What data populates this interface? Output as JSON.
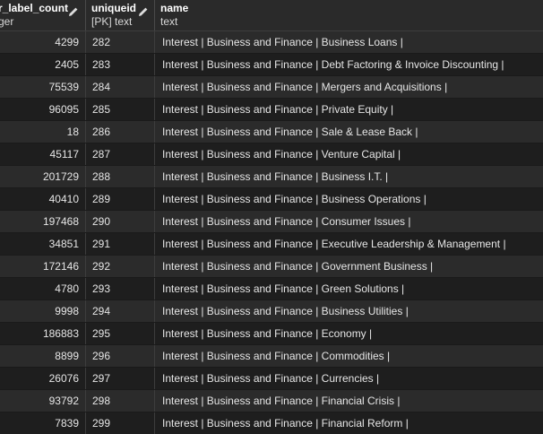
{
  "columns": [
    {
      "name": "r_label_count",
      "type": "ger"
    },
    {
      "name": "uniqueid",
      "type": "[PK] text"
    },
    {
      "name": "name",
      "type": "text"
    }
  ],
  "rows": [
    {
      "count": "4299",
      "id": "282",
      "name": "Interest | Business and Finance | Business Loans |"
    },
    {
      "count": "2405",
      "id": "283",
      "name": "Interest | Business and Finance | Debt Factoring & Invoice Discounting |"
    },
    {
      "count": "75539",
      "id": "284",
      "name": "Interest | Business and Finance | Mergers and Acquisitions |"
    },
    {
      "count": "96095",
      "id": "285",
      "name": "Interest | Business and Finance | Private Equity |"
    },
    {
      "count": "18",
      "id": "286",
      "name": "Interest | Business and Finance | Sale & Lease Back |"
    },
    {
      "count": "45117",
      "id": "287",
      "name": "Interest | Business and Finance | Venture Capital |"
    },
    {
      "count": "201729",
      "id": "288",
      "name": "Interest | Business and Finance | Business I.T. |"
    },
    {
      "count": "40410",
      "id": "289",
      "name": "Interest | Business and Finance | Business Operations |"
    },
    {
      "count": "197468",
      "id": "290",
      "name": "Interest | Business and Finance | Consumer Issues |"
    },
    {
      "count": "34851",
      "id": "291",
      "name": "Interest | Business and Finance | Executive Leadership & Management |"
    },
    {
      "count": "172146",
      "id": "292",
      "name": "Interest | Business and Finance | Government Business |"
    },
    {
      "count": "4780",
      "id": "293",
      "name": "Interest | Business and Finance | Green Solutions |"
    },
    {
      "count": "9998",
      "id": "294",
      "name": "Interest | Business and Finance | Business Utilities |"
    },
    {
      "count": "186883",
      "id": "295",
      "name": "Interest | Business and Finance | Economy |"
    },
    {
      "count": "8899",
      "id": "296",
      "name": "Interest | Business and Finance | Commodities |"
    },
    {
      "count": "26076",
      "id": "297",
      "name": "Interest | Business and Finance | Currencies |"
    },
    {
      "count": "93792",
      "id": "298",
      "name": "Interest | Business and Finance | Financial Crisis |"
    },
    {
      "count": "7839",
      "id": "299",
      "name": "Interest | Business and Finance | Financial Reform |"
    }
  ],
  "colors": {
    "header_bg": "#2a2a2a",
    "row_odd": "#2b2b2b",
    "row_even": "#1e1e1e",
    "text": "#e6e6e6"
  }
}
